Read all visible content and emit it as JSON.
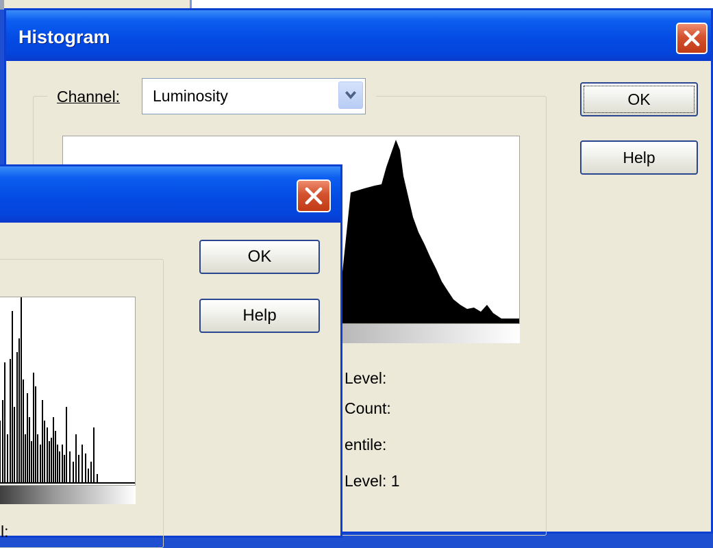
{
  "back_dialog": {
    "title": "Histogram",
    "channel_label": "Channel:",
    "channel_value": "Luminosity",
    "ok_label": "OK",
    "help_label": "Help",
    "stats": {
      "level_label": "Level:",
      "count_label": "Count:",
      "percentile_label": "entile:",
      "cache_level_label": "Level: 1"
    }
  },
  "front_dialog": {
    "ok_label": "OK",
    "help_label": "Help",
    "stat_fragment": "l:"
  },
  "colors": {
    "window_bg": "#ece9d8",
    "titlebar": "#0349e2",
    "desktop": "#1e4fd1",
    "close_button": "#d3522f"
  },
  "icons": [
    "close-icon",
    "chevron-down-icon"
  ]
}
